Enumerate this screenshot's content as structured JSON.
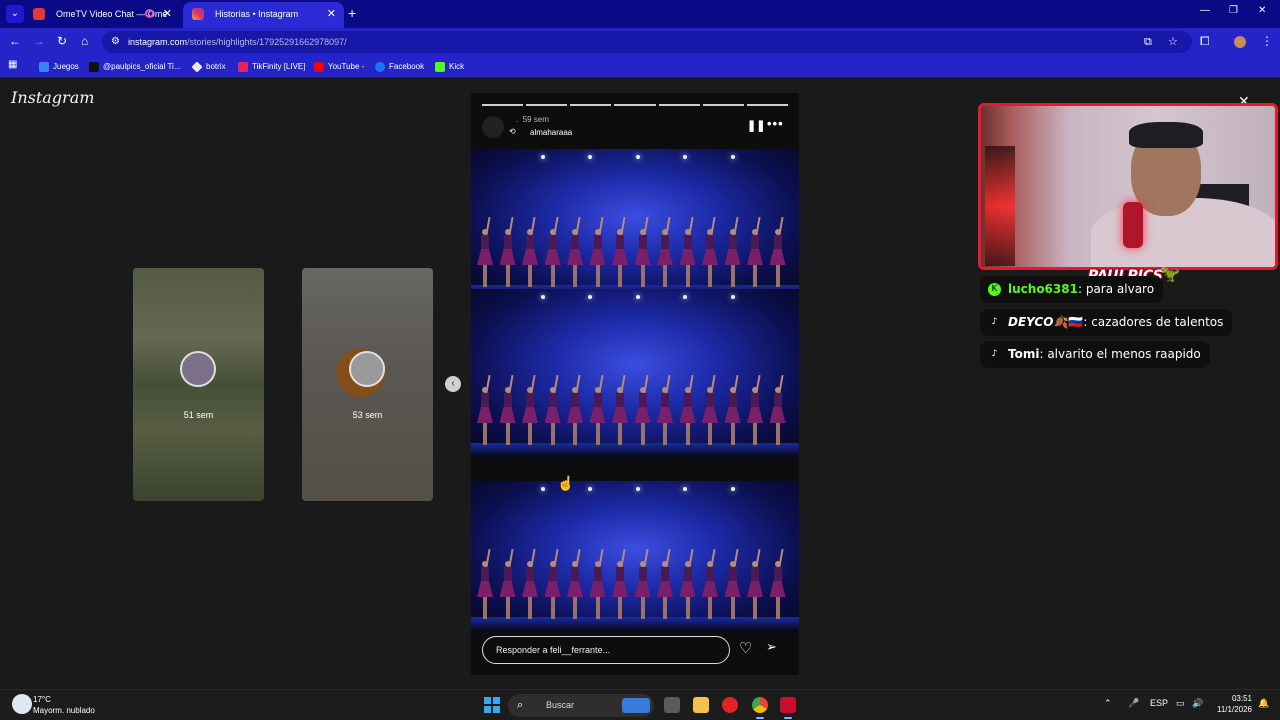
{
  "browser": {
    "tabs": [
      {
        "title": "OmeTV Video Chat — Ome",
        "active": false
      },
      {
        "title": "Historias • Instagram",
        "active": true
      }
    ],
    "url": {
      "host": "instagram.com",
      "path": "/stories/highlights/17925291662978097/"
    },
    "bookmarks": [
      "Juegos",
      "@paulpics_oficial Ti...",
      "botrix",
      "TikFinity [LIVE]",
      "YouTube -",
      "Facebook",
      "Kick"
    ]
  },
  "instagram": {
    "logo": "Instagram",
    "thumbnails": [
      {
        "time": "51 sem"
      },
      {
        "time": "53 sem"
      }
    ],
    "story": {
      "time": "59 sem",
      "separator": ".",
      "username": "almaharaaa",
      "segments": 7,
      "reply_placeholder": "Responder a feli__ferrante..."
    }
  },
  "stream": {
    "brand": "PAULPICS",
    "chat": [
      {
        "platform": "kick",
        "user": "lucho6381",
        "message": "para alvaro",
        "color": "#53fc18"
      },
      {
        "platform": "tiktok",
        "user": "DEYCO",
        "badges": "🍂🇷🇺",
        "message": "cazadores de talentos",
        "color": "#ffffff"
      },
      {
        "platform": "tiktok",
        "user": "Tomi",
        "message": "alvarito el menos raapido",
        "color": "#ffffff"
      }
    ]
  },
  "taskbar": {
    "weather": {
      "temp": "17°C",
      "desc": "Mayorm. nublado"
    },
    "search_placeholder": "Buscar",
    "language": "ESP",
    "time": "03:51",
    "date": "11/1/2026"
  },
  "colors": {
    "tabbar": "#0a0a86",
    "toolbar": "#2424c8",
    "page_bg": "#1a1a1a",
    "cam_border": "#e8162e",
    "kick_green": "#53fc18"
  }
}
